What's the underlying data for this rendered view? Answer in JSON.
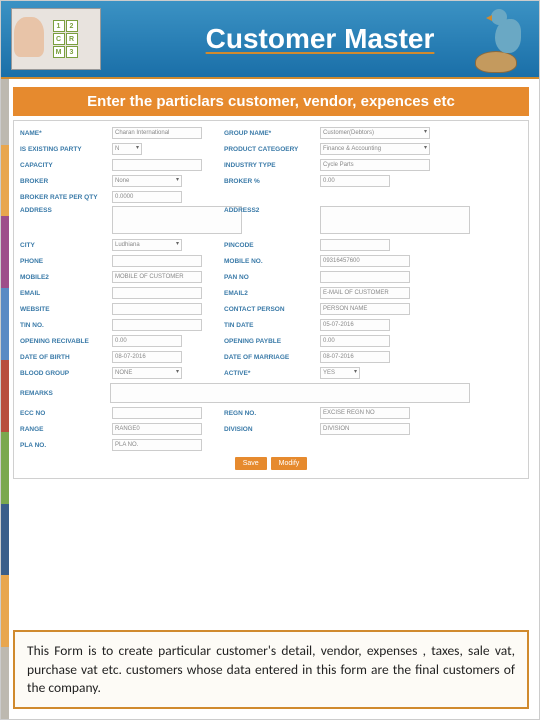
{
  "header": {
    "title": "Customer Master"
  },
  "subheader": "Enter the particlars customer, vendor, expences etc",
  "form": {
    "name": {
      "label": "NAME*",
      "value": "Charan International"
    },
    "groupName": {
      "label": "GROUP NAME*",
      "value": "Customer(Debtors)"
    },
    "existingParty": {
      "label": "IS EXISTING PARTY",
      "value": "N"
    },
    "productCategory": {
      "label": "PRODUCT CATEGOERY",
      "value": "Finance & Accounting"
    },
    "capacity": {
      "label": "CAPACITY",
      "value": ""
    },
    "industryType": {
      "label": "INDUSTRY TYPE",
      "value": "Cycle Parts"
    },
    "broker": {
      "label": "BROKER",
      "value": "None"
    },
    "brokerPct": {
      "label": "BROKER %",
      "value": "0.00"
    },
    "brokerRate": {
      "label": "BROKER RATE PER QTY",
      "value": "0.0000"
    },
    "address": {
      "label": "ADDRESS",
      "value": ""
    },
    "address2": {
      "label": "ADDRESS2",
      "value": ""
    },
    "city": {
      "label": "CITY",
      "value": "Ludhiana"
    },
    "pincode": {
      "label": "PINCODE",
      "value": ""
    },
    "phone": {
      "label": "PHONE",
      "value": ""
    },
    "mobile": {
      "label": "MOBILE NO.",
      "value": "09316457600"
    },
    "mobile2": {
      "label": "MOBILE2",
      "value": "MOBILE OF CUSTOMER"
    },
    "pan": {
      "label": "PAN NO",
      "value": ""
    },
    "email": {
      "label": "EMAIL",
      "value": ""
    },
    "email2": {
      "label": "EMAIL2",
      "value": "E-MAIL OF CUSTOMER"
    },
    "website": {
      "label": "WEBSITE",
      "value": ""
    },
    "contactPerson": {
      "label": "CONTACT PERSON",
      "value": "PERSON NAME"
    },
    "tinNo": {
      "label": "TIN NO.",
      "value": ""
    },
    "tinDate": {
      "label": "TIN DATE",
      "value": "05-07-2016"
    },
    "openRecv": {
      "label": "OPENING RECIVABLE",
      "value": "0.00"
    },
    "openPay": {
      "label": "OPENING PAYBLE",
      "value": "0.00"
    },
    "dob": {
      "label": "DATE OF BIRTH",
      "value": "08-07-2016"
    },
    "dom": {
      "label": "DATE OF MARRIAGE",
      "value": "08-07-2016"
    },
    "bloodGroup": {
      "label": "BLOOD GROUP",
      "value": "NONE"
    },
    "active": {
      "label": "ACTIVE*",
      "value": "YES"
    },
    "remarks": {
      "label": "REMARKS",
      "value": ""
    },
    "ecc": {
      "label": "ECC NO",
      "value": ""
    },
    "regn": {
      "label": "REGN NO.",
      "value": "EXCISE REGN NO"
    },
    "range": {
      "label": "RANGE",
      "value": "RANGE0"
    },
    "division": {
      "label": "DIVISION",
      "value": "DIVISION"
    },
    "pla": {
      "label": "PLA NO.",
      "value": "PLA NO."
    }
  },
  "buttons": {
    "save": "Save",
    "modify": "Modify"
  },
  "footer": "This  Form is to create  particular customer's detail, vendor, expenses , taxes, sale vat, purchase vat etc. customers whose data entered in this form are the final customers of the company."
}
